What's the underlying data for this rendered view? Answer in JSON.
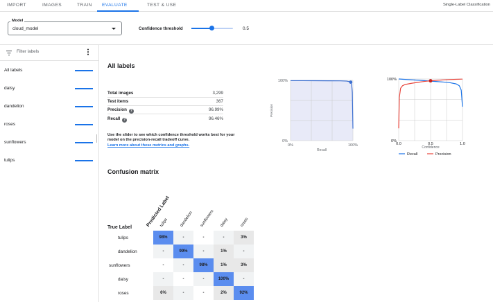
{
  "tabs": [
    {
      "label": "IMPORT"
    },
    {
      "label": "IMAGES"
    },
    {
      "label": "TRAIN"
    },
    {
      "label": "EVALUATE"
    },
    {
      "label": "TEST & USE"
    }
  ],
  "active_tab": "EVALUATE",
  "app_mode": "Single-Label Classification",
  "model_select": {
    "label": "Model",
    "value": "cloud_model"
  },
  "threshold": {
    "label": "Confidence threshold",
    "value": "0.5",
    "level": 0.5
  },
  "sidebar": {
    "filter_placeholder": "Filter labels",
    "items": [
      {
        "label": "All labels"
      },
      {
        "label": "daisy"
      },
      {
        "label": "dandelion"
      },
      {
        "label": "roses"
      },
      {
        "label": "sunflowers"
      },
      {
        "label": "tulips"
      }
    ]
  },
  "main": {
    "title": "All labels",
    "metrics": [
      {
        "key": "Total images",
        "value": "3,299",
        "help": false
      },
      {
        "key": "Test items",
        "value": "367",
        "help": false
      },
      {
        "key": "Precision",
        "value": "96.99%",
        "help": true
      },
      {
        "key": "Recall",
        "value": "96.46%",
        "help": true
      }
    ],
    "description": "Use the slider to see which confidence threshold works best for your model on the precision-recall tradeoff curve.",
    "learn_link": "Learn more about these metrics and graphs.",
    "help_glyph": "?"
  },
  "chart_data": [
    {
      "type": "area",
      "title": "",
      "xlabel": "Recall",
      "ylabel": "Precision",
      "xlim": [
        0,
        100
      ],
      "ylim": [
        0,
        100
      ],
      "x_tick_labels": [
        "0%",
        "100%"
      ],
      "y_tick_labels": [
        "0%",
        "100%"
      ],
      "grid": true,
      "series": [
        {
          "name": "",
          "x": [
            0,
            20,
            40,
            60,
            80,
            90,
            94,
            96.5,
            98,
            99,
            100
          ],
          "y": [
            99.5,
            99.5,
            99.4,
            99.3,
            99.2,
            98.8,
            98,
            97,
            93,
            80,
            20
          ]
        }
      ],
      "highlight": {
        "x": 96.5,
        "y": 97
      }
    },
    {
      "type": "line",
      "title": "",
      "xlabel": "Confidence",
      "x_tick_labels": [
        "0.0",
        "0.5",
        "1.0"
      ],
      "y_tick_labels": [
        "0%",
        "100%"
      ],
      "xlim": [
        0,
        1
      ],
      "ylim": [
        0,
        100
      ],
      "grid": true,
      "legend_position": "bottom",
      "series": [
        {
          "name": "Recall",
          "x": [
            0,
            0.1,
            0.2,
            0.3,
            0.4,
            0.5,
            0.6,
            0.7,
            0.8,
            0.9,
            0.95,
            0.98,
            1.0
          ],
          "y": [
            100,
            99.3,
            98.6,
            98,
            97.3,
            96.5,
            95.8,
            95,
            94,
            92,
            89,
            82,
            55
          ]
        },
        {
          "name": "Precision",
          "x": [
            0,
            0.01,
            0.03,
            0.06,
            0.1,
            0.2,
            0.3,
            0.4,
            0.5,
            0.6,
            0.7,
            0.8,
            0.9,
            1.0
          ],
          "y": [
            20,
            70,
            85,
            89,
            91,
            93,
            94.5,
            96,
            97,
            97.8,
            98.5,
            99,
            99.4,
            99.8
          ]
        }
      ],
      "highlight": {
        "x": 0.5,
        "y": 97
      },
      "colors": {
        "Recall": "#1a73e8",
        "Precision": "#e8453c"
      }
    }
  ],
  "confusion": {
    "title": "Confusion matrix",
    "true_label": "True Label",
    "predicted_label": "Predicted Label",
    "columns": [
      "tulips",
      "dandelion",
      "sunflowers",
      "daisy",
      "roses"
    ],
    "rows": [
      {
        "label": "tulips",
        "cells": [
          "98%",
          "-",
          "-",
          "-",
          "3%"
        ]
      },
      {
        "label": "dandelion",
        "cells": [
          "-",
          "99%",
          "-",
          "1%",
          "-"
        ]
      },
      {
        "label": "sunflowers",
        "cells": [
          "-",
          "-",
          "98%",
          "1%",
          "3%"
        ]
      },
      {
        "label": "daisy",
        "cells": [
          "-",
          "-",
          "-",
          "100%",
          "-"
        ]
      },
      {
        "label": "roses",
        "cells": [
          "6%",
          "-",
          "-",
          "2%",
          "92%"
        ]
      }
    ]
  },
  "colors": {
    "accent": "#1a73e8",
    "cell_high": "#5b8def",
    "cell_low": "#e8e8e8",
    "cell_empty": "#f1f3f4"
  }
}
